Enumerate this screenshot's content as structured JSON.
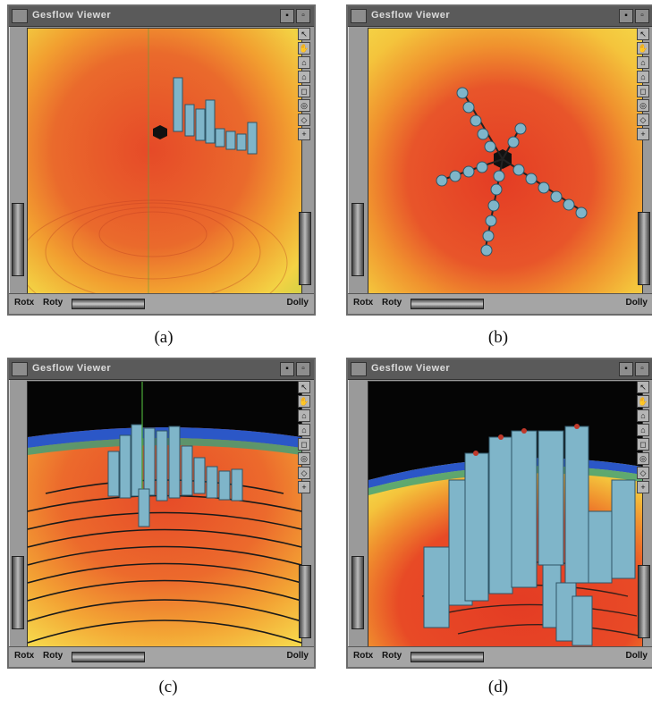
{
  "window": {
    "title": "Gesflow Viewer",
    "labels": {
      "rotx": "Rotx",
      "roty": "Roty",
      "dolly": "Dolly"
    }
  },
  "panels": [
    {
      "caption": "(a)"
    },
    {
      "caption": "(b)"
    },
    {
      "caption": "(c)"
    },
    {
      "caption": "(d)"
    }
  ],
  "toolbar_icons": [
    "pointer-icon",
    "hand-icon",
    "home-icon",
    "set-home-icon",
    "view-all-icon",
    "seek-icon",
    "perspective-icon",
    "zoom-icon"
  ],
  "colors": {
    "field_outer": "#f6e24a",
    "field_mid": "#f19a2e",
    "field_inner": "#e8542a",
    "pipe": "#7fb5c9",
    "sky": "#050505",
    "horizon": "#2b57c7"
  }
}
